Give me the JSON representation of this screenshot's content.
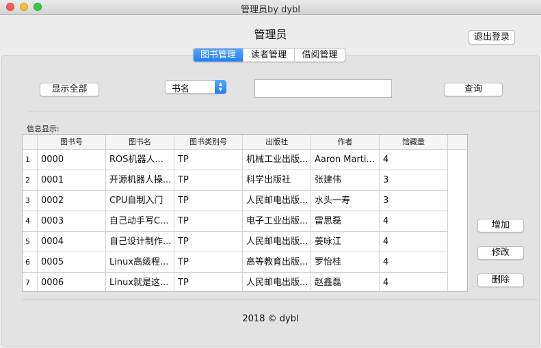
{
  "window": {
    "title": "管理员by dybl"
  },
  "header": {
    "title": "管理员",
    "logout_label": "退出登录"
  },
  "tabs": [
    {
      "label": "图书管理",
      "active": true
    },
    {
      "label": "读者管理",
      "active": false
    },
    {
      "label": "借阅管理",
      "active": false
    }
  ],
  "toolbar": {
    "show_all_label": "显示全部",
    "search_field_selected": "书名",
    "search_value": "",
    "query_label": "查询"
  },
  "info_label": "信息显示:",
  "table": {
    "columns": [
      "",
      "图书号",
      "图书名",
      "图书类别号",
      "出版社",
      "作者",
      "馆藏量"
    ],
    "rows": [
      [
        "1",
        "0000",
        "ROS机器人...",
        "TP",
        "机械工业出版...",
        "Aaron Marti...",
        "4"
      ],
      [
        "2",
        "0001",
        "开源机器人操...",
        "TP",
        "科学出版社",
        "张建伟",
        "3"
      ],
      [
        "3",
        "0002",
        "CPU自制入门",
        "TP",
        "人民邮电出版...",
        "水头一寿",
        "3"
      ],
      [
        "4",
        "0003",
        "自己动手写C...",
        "TP",
        "电子工业出版...",
        "雷思磊",
        "4"
      ],
      [
        "5",
        "0004",
        "自己设计制作...",
        "TP",
        "人民邮电出版...",
        "姜咏江",
        "4"
      ],
      [
        "6",
        "0005",
        "Linux高级程...",
        "TP",
        "高等教育出版...",
        "罗怡桂",
        "4"
      ],
      [
        "7",
        "0006",
        "Linux就是这...",
        "TP",
        "人民邮电出版...",
        "赵鑫磊",
        "4"
      ]
    ]
  },
  "actions": {
    "add_label": "增加",
    "edit_label": "修改",
    "delete_label": "删除"
  },
  "footer": {
    "text": "2018 ©  dybl"
  },
  "colors": {
    "accent": "#1e7cf7",
    "close": "#fc605c",
    "minimize": "#fdbc40",
    "maximize": "#34c84a"
  }
}
